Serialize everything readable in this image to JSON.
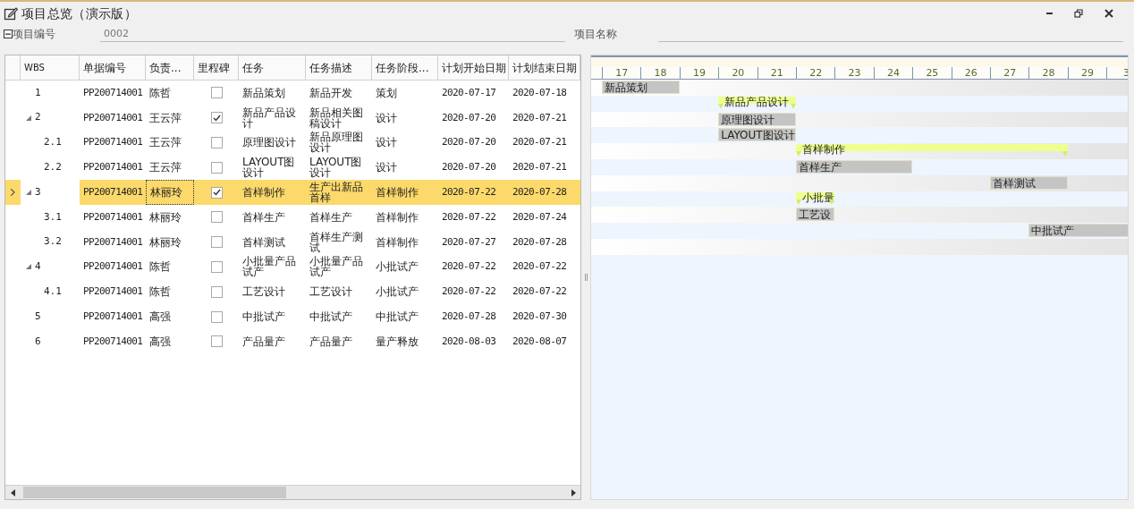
{
  "window": {
    "title": "项目总览（演示版）"
  },
  "form": {
    "fields": [
      {
        "label": "项目编号",
        "value": "0002"
      },
      {
        "label": "项目名称"
      }
    ]
  },
  "table": {
    "columns": [
      "WBS",
      "单据编号",
      "负责...",
      "里程碑",
      "任务",
      "任务描述",
      "任务阶段...",
      "计划开始日期",
      "计划结束日期"
    ],
    "rows": [
      {
        "wbs": "1",
        "doc_no": "PP200714001",
        "owner": "陈哲",
        "milestone": false,
        "task": "新品策划",
        "description": "新品开发",
        "phase": "策划",
        "start": "2020-07-17",
        "end": "2020-07-18",
        "selected": false
      },
      {
        "wbs": "2",
        "doc_no": "PP200714001",
        "owner": "王云萍",
        "milestone": true,
        "task": "新品产品设计",
        "description": "新品相关图稿设计",
        "phase": "设计",
        "start": "2020-07-20",
        "end": "2020-07-21",
        "selected": false,
        "expanded": true,
        "children": [
          {
            "wbs": "2.1",
            "doc_no": "PP200714001",
            "owner": "王云萍",
            "milestone": false,
            "task": "原理图设计",
            "description": "新品原理图设计",
            "phase": "设计",
            "start": "2020-07-20",
            "end": "2020-07-21",
            "selected": false
          },
          {
            "wbs": "2.2",
            "doc_no": "PP200714001",
            "owner": "王云萍",
            "milestone": false,
            "task": "LAYOUT图设计",
            "description": "LAYOUT图设计",
            "phase": "设计",
            "start": "2020-07-20",
            "end": "2020-07-21",
            "selected": false
          }
        ]
      },
      {
        "wbs": "3",
        "doc_no": "PP200714001",
        "owner": "林丽玲",
        "milestone": true,
        "task": "首样制作",
        "description": "生产出新品首样",
        "phase": "首样制作",
        "start": "2020-07-22",
        "end": "2020-07-28",
        "selected": true,
        "expanded": true,
        "children": [
          {
            "wbs": "3.1",
            "doc_no": "PP200714001",
            "owner": "林丽玲",
            "milestone": false,
            "task": "首样生产",
            "description": "首样生产",
            "phase": "首样制作",
            "start": "2020-07-22",
            "end": "2020-07-24",
            "selected": false
          },
          {
            "wbs": "3.2",
            "doc_no": "PP200714001",
            "owner": "林丽玲",
            "milestone": false,
            "task": "首样测试",
            "description": "首样生产测试",
            "phase": "首样制作",
            "start": "2020-07-27",
            "end": "2020-07-28",
            "selected": false
          }
        ]
      },
      {
        "wbs": "4",
        "doc_no": "PP200714001",
        "owner": "陈哲",
        "milestone": false,
        "task": "小批量产品试产",
        "description": "小批量产品试产",
        "phase": "小批试产",
        "start": "2020-07-22",
        "end": "2020-07-22",
        "selected": false,
        "expanded": true,
        "children": [
          {
            "wbs": "4.1",
            "doc_no": "PP200714001",
            "owner": "陈哲",
            "milestone": false,
            "task": "工艺设计",
            "description": "工艺设计",
            "phase": "小批试产",
            "start": "2020-07-22",
            "end": "2020-07-22",
            "selected": false
          }
        ]
      },
      {
        "wbs": "5",
        "doc_no": "PP200714001",
        "owner": "高强",
        "milestone": false,
        "task": "中批试产",
        "description": "中批试产",
        "phase": "中批试产",
        "start": "2020-07-28",
        "end": "2020-07-30",
        "selected": false
      },
      {
        "wbs": "6",
        "doc_no": "PP200714001",
        "owner": "高强",
        "milestone": false,
        "task": "产品量产",
        "description": "产品量产",
        "phase": "量产释放",
        "start": "2020-08-03",
        "end": "2020-08-07",
        "selected": false
      }
    ]
  },
  "gantt": {
    "days": [
      "17",
      "18",
      "19",
      "20",
      "21",
      "22",
      "23",
      "24",
      "25",
      "26",
      "27",
      "28",
      "29",
      "3"
    ],
    "bars": [
      {
        "label": "新品策划",
        "kind": "task"
      },
      {
        "label": "新品产品设计",
        "kind": "summary"
      },
      {
        "label": "原理图设计",
        "kind": "task"
      },
      {
        "label": "LAYOUT图设计",
        "kind": "task"
      },
      {
        "label": "首样制作",
        "kind": "summary"
      },
      {
        "label": "首样生产",
        "kind": "task"
      },
      {
        "label": "首样测试",
        "kind": "task"
      },
      {
        "label": "小批量",
        "kind": "summary"
      },
      {
        "label": "工艺设",
        "kind": "task"
      },
      {
        "label": "中批试产",
        "kind": "task"
      }
    ]
  }
}
